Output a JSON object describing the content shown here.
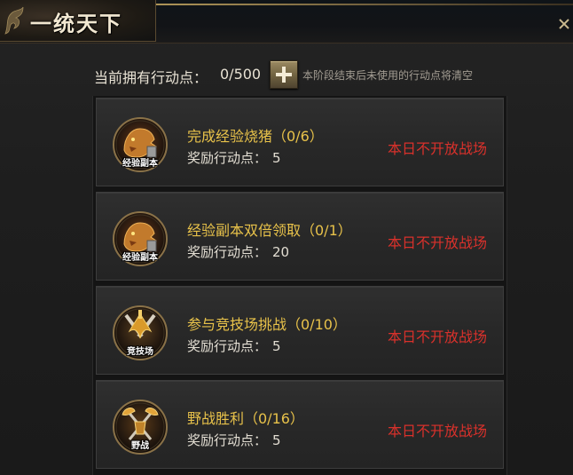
{
  "window": {
    "title": "一统天下"
  },
  "header": {
    "points_label": "当前拥有行动点：",
    "points_value": "0/500",
    "plus_icon": "plus-icon",
    "note": "本阶段结束后未使用的行动点将清空"
  },
  "tasks": [
    {
      "icon": "dungeon-beast-icon",
      "icon_caption": "经验副本",
      "name": "完成经验烧猪（0/6）",
      "reward_label": "奖励行动点：",
      "reward_value": "5",
      "status": "本日不开放战场"
    },
    {
      "icon": "dungeon-beast-icon",
      "icon_caption": "经验副本",
      "name": "经验副本双倍领取（0/1）",
      "reward_label": "奖励行动点：",
      "reward_value": "20",
      "status": "本日不开放战场"
    },
    {
      "icon": "arena-swords-icon",
      "icon_caption": "竞技场",
      "name": "参与竞技场挑战（0/10）",
      "reward_label": "奖励行动点：",
      "reward_value": "5",
      "status": "本日不开放战场"
    },
    {
      "icon": "field-battle-axes-icon",
      "icon_caption": "野战",
      "name": "野战胜利（0/16）",
      "reward_label": "奖励行动点：",
      "reward_value": "5",
      "status": "本日不开放战场"
    }
  ],
  "colors": {
    "task_name": "#e8c24a",
    "status": "#d9312b",
    "text": "#e2ddd2"
  }
}
